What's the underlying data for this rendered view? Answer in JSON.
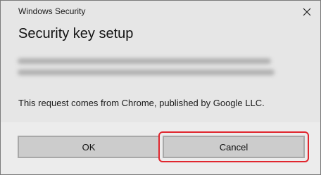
{
  "window": {
    "title": "Windows Security",
    "close_icon": "close-icon"
  },
  "dialog": {
    "heading": "Security key setup",
    "request_text": "This request comes from Chrome, published by Google LLC."
  },
  "buttons": {
    "ok_label": "OK",
    "cancel_label": "Cancel"
  },
  "colors": {
    "highlight": "#e0262e",
    "background": "#e6e6e6",
    "button": "#cccccc"
  }
}
